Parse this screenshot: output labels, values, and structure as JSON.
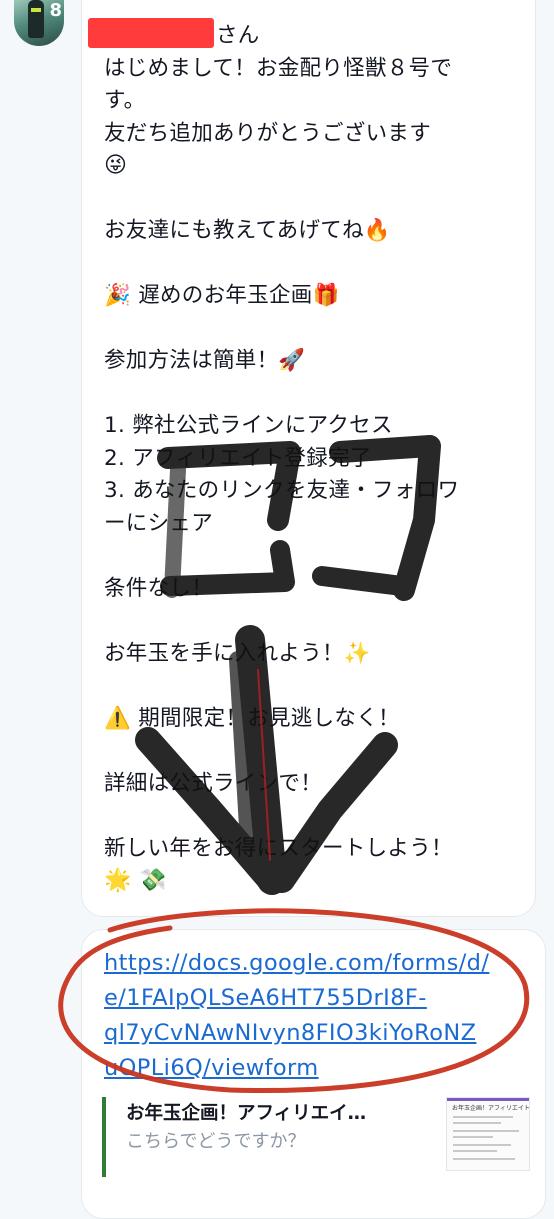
{
  "message": {
    "greeting_suffix": "さん",
    "lines": [
      "はじめまして！お金配り怪獣８号で",
      "す。",
      "友だち追加ありがとうございます",
      "😜",
      "",
      "お友達にも教えてあげてね🔥",
      "",
      "🎉 遅めのお年玉企画🎁",
      "",
      "参加方法は簡単！🚀",
      "",
      "1. 弊社公式ラインにアクセス",
      "2. アフィリエイト登録完了",
      "3. あなたのリンクを友達・フォロワ",
      "ーにシェア",
      "",
      "条件なし！",
      "",
      "お年玉を手に入れよう！✨",
      "",
      "⚠️ 期間限定！お見逃しなく！",
      "",
      "詳細は公式ラインで！",
      "",
      "新しい年をお得にスタートしよう！",
      "🌟 💸"
    ]
  },
  "link": {
    "lines": [
      "https://docs.google.com/forms/d/",
      "e/1FAIpQLSeA6HT755DrI8F-",
      "ql7yCvNAwNIvyn8FIO3kiYoRoNZ",
      "uOPLi6Q/viewform"
    ]
  },
  "link_card": {
    "title": "お年玉企画！アフィリエイ…",
    "subtitle": "こちらでどうですか？",
    "thumb_heading": "お年玉企画！アフィリエイト",
    "accent": "#2e7d32"
  },
  "avatar": {
    "badge": "8"
  },
  "annotation": {
    "text": "ココ",
    "circle_color": "#c8341f",
    "ink_color": "#111111"
  },
  "colors": {
    "link": "#1b6ad1",
    "redaction": "#ff2a2a"
  }
}
